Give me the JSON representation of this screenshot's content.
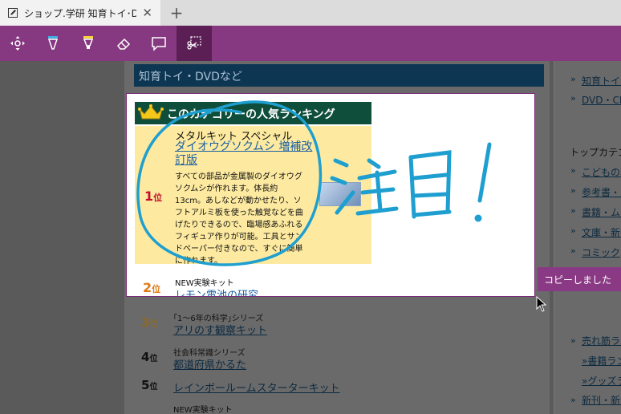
{
  "browser": {
    "tab_title": "ショップ.学研 知育トイ･DV",
    "close_glyph": "✕",
    "new_tab_glyph": "+"
  },
  "toolbar": {
    "tools": [
      "pan-icon",
      "pen-icon",
      "highlighter-icon",
      "eraser-icon",
      "comment-icon",
      "clip-icon"
    ],
    "active_tool": "clip-icon",
    "accent_color": "#863880"
  },
  "page": {
    "section_header": "知育トイ・DVDなど",
    "ranking_banner": "このカテゴリーの人気ランキング",
    "ranking": [
      {
        "rank": "1",
        "rank_suffix": "位",
        "series": "メタルキット スペシャル",
        "title": "ダイオウグソクムシ 増補改訂版",
        "description": "すべての部品が金属製のダイオウグソクムシが作れます。体長約13cm。あしなどが動かせたり、ソフトアルミ板を使った触覚などを曲げたりできるので、臨場感あふれるフィギュア作りが可能。工具とサンドペーパー付きなので、すぐに簡単に作れます。"
      },
      {
        "rank": "2",
        "rank_suffix": "位",
        "series": "NEW実験キット",
        "title": "レモン電池の研究"
      },
      {
        "rank": "3",
        "rank_suffix": "位",
        "series": "｢1〜6年の科学｣シリーズ",
        "title": "アリのす観察キット"
      },
      {
        "rank": "4",
        "rank_suffix": "位",
        "series": "社会科常識シリーズ",
        "title": "都道府県かるた"
      },
      {
        "rank": "5",
        "rank_suffix": "位",
        "series": "",
        "title": "レインボールームスターターキット"
      },
      {
        "rank": "",
        "rank_suffix": "",
        "series": "NEW実験キット",
        "title": ""
      }
    ],
    "sidebar": {
      "arrow": "»",
      "top_links": [
        "知育トイ・D",
        "DVD・CD"
      ],
      "heading": "トップカテゴ",
      "category_links": [
        "こどもの本",
        "参考書・問",
        "書籍・ムッ",
        "文庫・新書",
        "コミック"
      ],
      "bottom_links": [
        "売れ筋ラン",
        "»書籍ラン",
        "»グッズラ",
        "新刊・新発"
      ]
    }
  },
  "annotation": {
    "handwriting": "注目!",
    "ink_color": "#1e9fd0"
  },
  "toast": {
    "message": "コピーしました"
  }
}
